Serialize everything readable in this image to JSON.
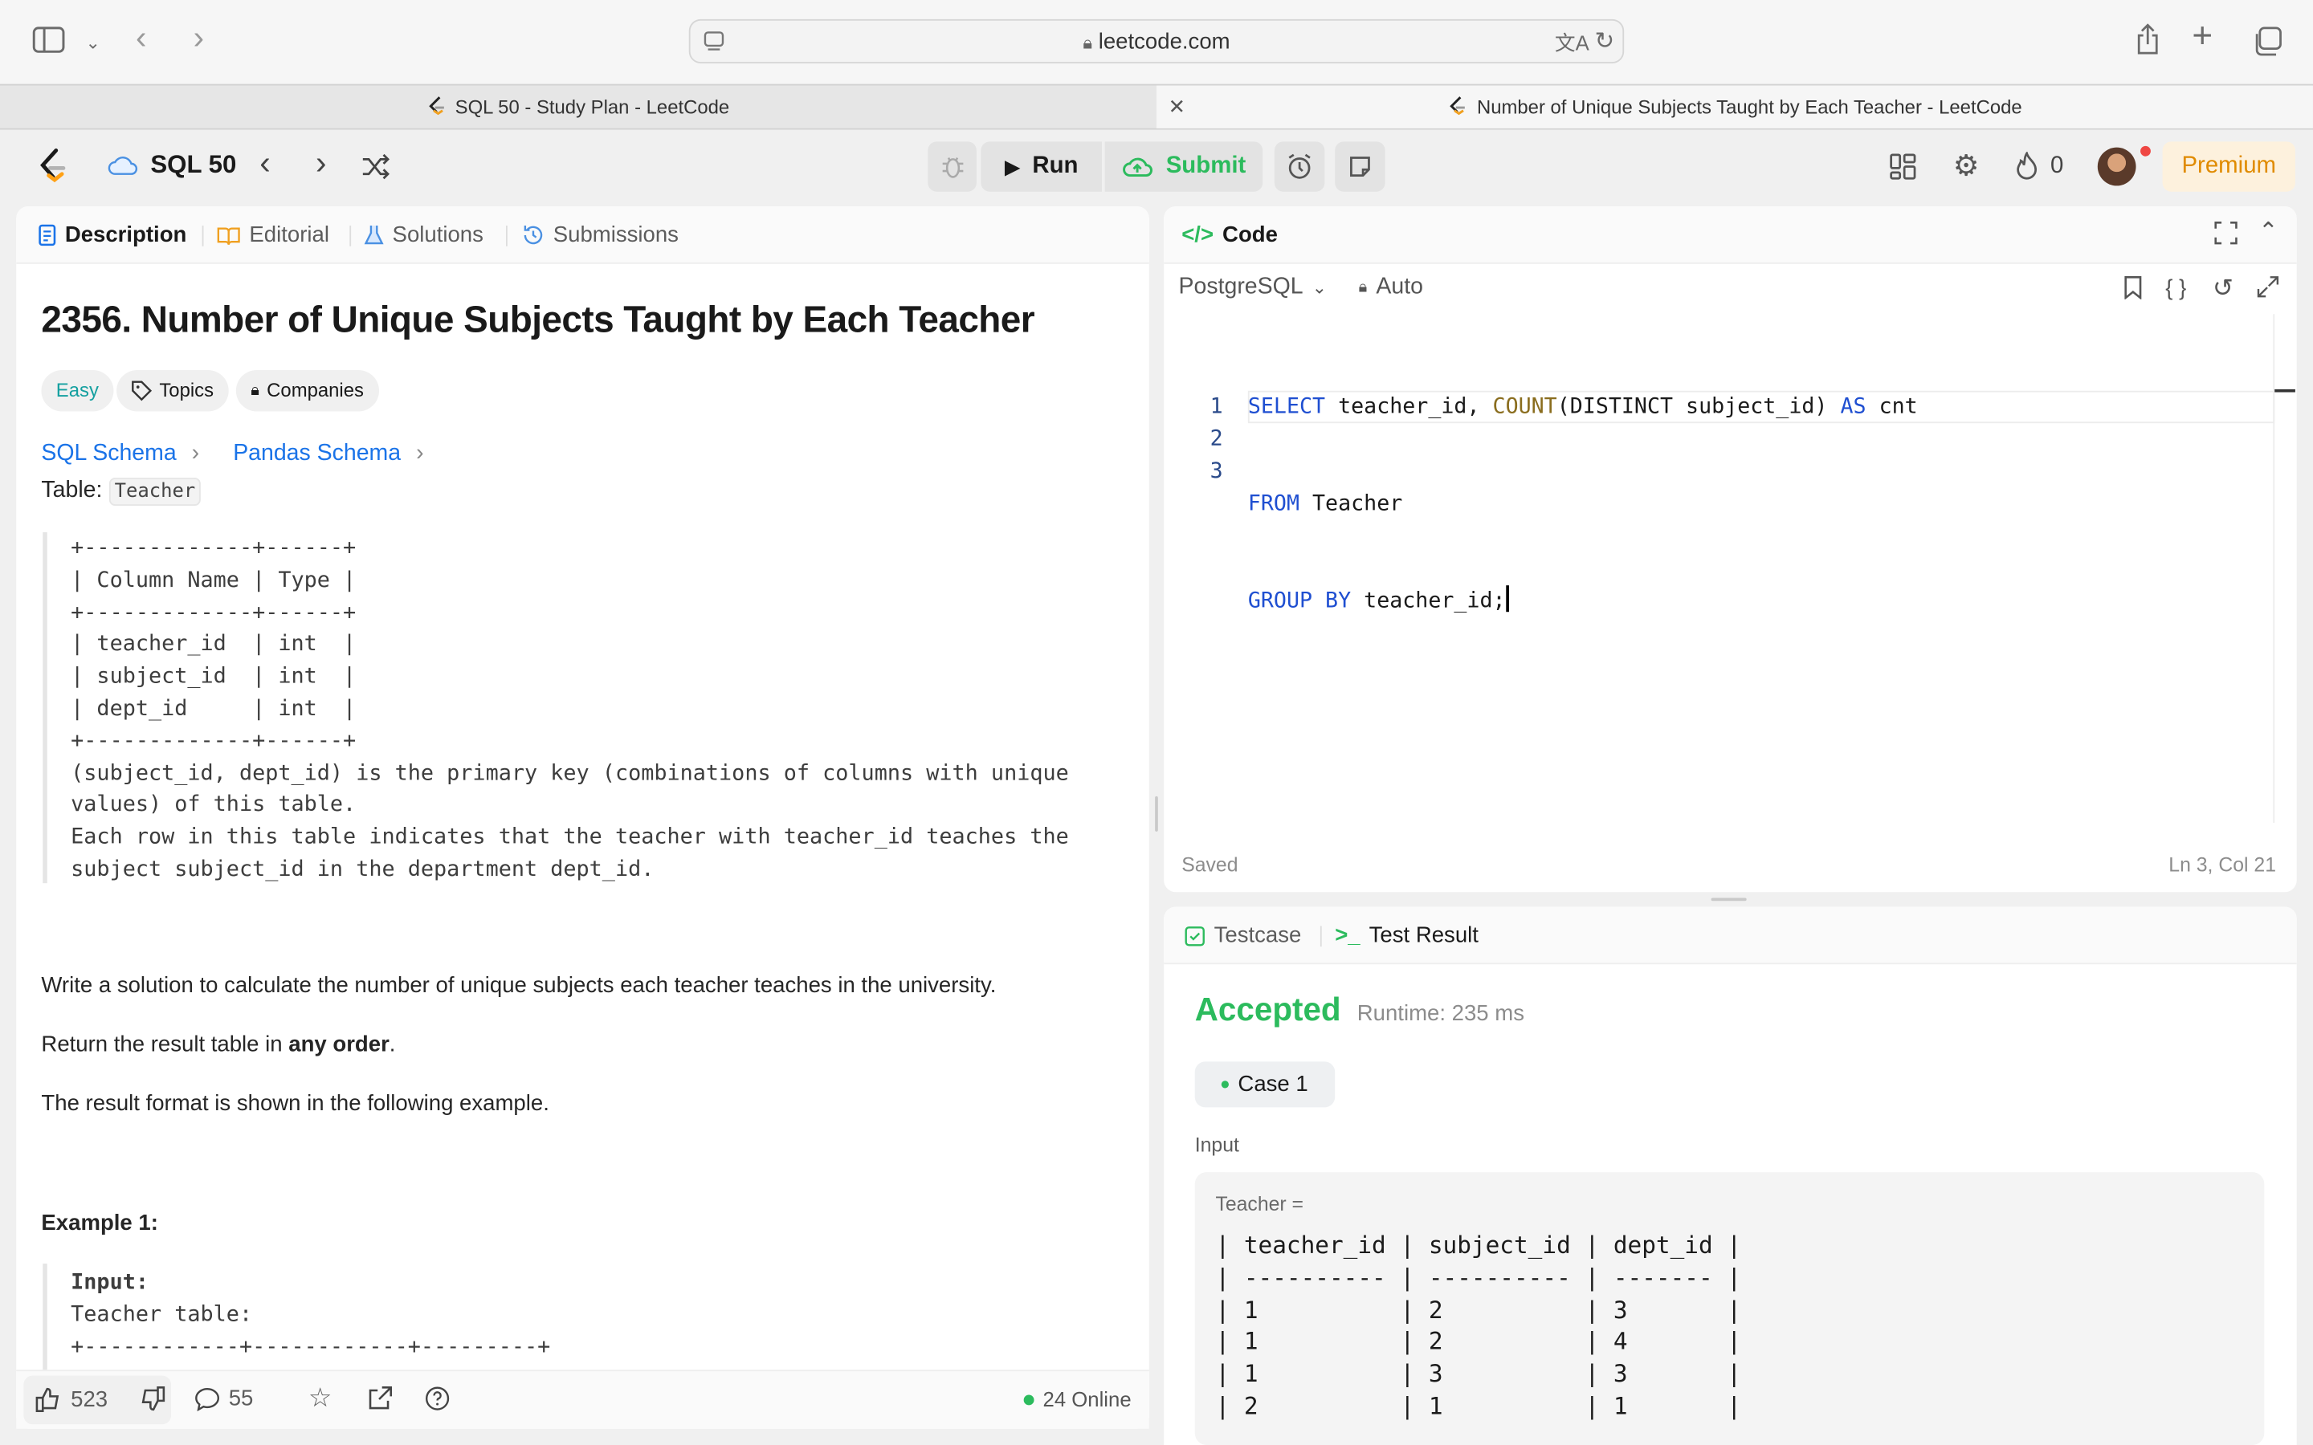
{
  "browser": {
    "url": "leetcode.com",
    "tabs": [
      {
        "title": "SQL 50 - Study Plan - LeetCode",
        "active": false
      },
      {
        "title": "Number of Unique Subjects Taught by Each Teacher - LeetCode",
        "active": true
      }
    ]
  },
  "header": {
    "plan_name": "SQL 50",
    "run_label": "Run",
    "submit_label": "Submit",
    "streak": "0",
    "premium_label": "Premium"
  },
  "left_panel": {
    "tabs": [
      "Description",
      "Editorial",
      "Solutions",
      "Submissions"
    ],
    "title": "2356. Number of Unique Subjects Taught by Each Teacher",
    "difficulty": "Easy",
    "topics_label": "Topics",
    "companies_label": "Companies",
    "sql_schema": "SQL Schema",
    "pandas_schema": "Pandas Schema",
    "table_prefix": "Table: ",
    "table_name": "Teacher",
    "schema_block": "+-------------+------+\n| Column Name | Type |\n+-------------+------+\n| teacher_id  | int  |\n| subject_id  | int  |\n| dept_id     | int  |\n+-------------+------+\n(subject_id, dept_id) is the primary key (combinations of columns with unique\nvalues) of this table.\nEach row in this table indicates that the teacher with teacher_id teaches the\nsubject subject_id in the department dept_id.",
    "para1": "Write a solution to calculate the number of unique subjects each teacher teaches in the university.",
    "para2_pre": "Return the result table in ",
    "para2_bold": "any order",
    "para2_post": ".",
    "para3": "The result format is shown in the following example.",
    "example_title": "Example 1:",
    "example_input_label": "Input:",
    "example_block": "Teacher table:\n+------------+------------+---------+",
    "likes": "523",
    "comments": "55",
    "online": "24 Online"
  },
  "editor": {
    "header_label": "Code",
    "language": "PostgreSQL",
    "auto_label": "Auto",
    "line_numbers": [
      "1",
      "2",
      "3"
    ],
    "line1": {
      "kw1": "SELECT",
      "t1": " teacher_id, ",
      "fn": "COUNT",
      "t2": "(DISTINCT subject_id) ",
      "kw2": "AS",
      "t3": " cnt"
    },
    "line2": {
      "kw": "FROM",
      "t": " Teacher"
    },
    "line3": {
      "kw": "GROUP BY",
      "t": " teacher_id;"
    },
    "status": "Saved",
    "cursor_pos": "Ln 3, Col 21"
  },
  "result": {
    "tabs": [
      "Testcase",
      "Test Result"
    ],
    "verdict": "Accepted",
    "runtime": "Runtime: 235 ms",
    "case_label": "Case 1",
    "input_label": "Input",
    "table_label": "Teacher =",
    "table_block": "| teacher_id | subject_id | dept_id |\n| ---------- | ---------- | ------- |\n| 1          | 2          | 3       |\n| 1          | 2          | 4       |\n| 1          | 3          | 3       |\n| 2          | 1          | 1       |"
  },
  "colors": {
    "accent_green": "#2cbb5d",
    "easy": "#15a0a0",
    "premium": "#e08b00",
    "link": "#1a73e8"
  }
}
